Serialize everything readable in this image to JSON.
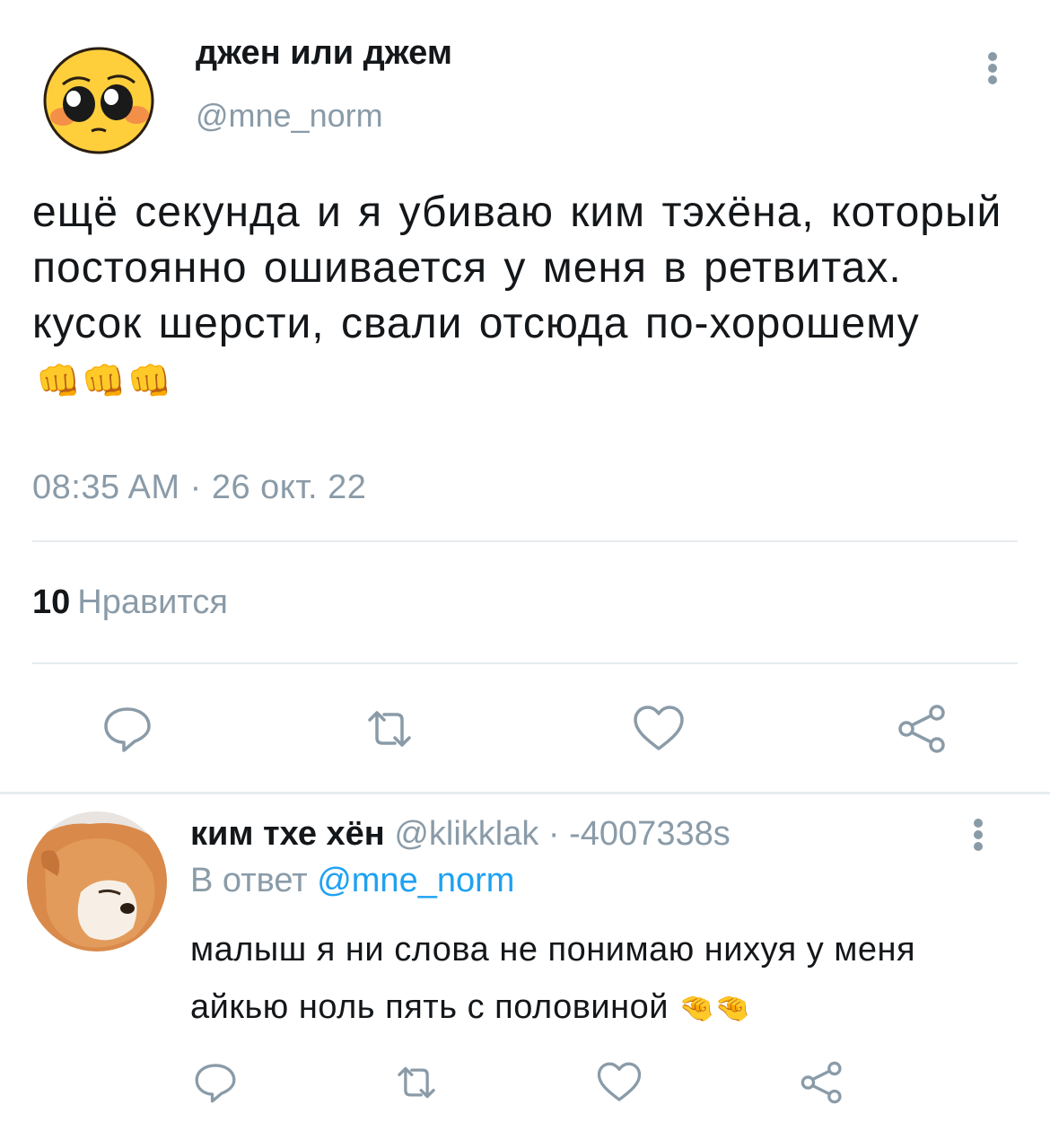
{
  "tweet": {
    "author_name": "джен или джем",
    "author_handle": "@mne_norm",
    "avatar_icon": "blushing-emoji-avatar",
    "text": "ещё секунда и я убиваю ким тэхёна, который постоянно ошивается у меня в ретвитах. кусок шерсти, свали отсюда по-хорошему",
    "emoji": "👊👊👊",
    "timestamp": "08:35 AM · 26 окт. 22",
    "likes_count": "10",
    "likes_label": "Нравится"
  },
  "reply": {
    "author_name": "ким тхе хён",
    "meta": " @klikklak · -4007338s",
    "reply_prefix": "В ответ ",
    "reply_mention": "@mne_norm",
    "avatar_icon": "shiba-dog-avatar",
    "text": "малыш я ни слова не понимаю нихуя у меня айкью ноль пять с половиной",
    "emoji": "🤏🤏"
  },
  "actions": [
    "reply-icon",
    "retweet-icon",
    "like-icon",
    "share-icon"
  ],
  "colors": {
    "text": "#14171a",
    "secondary": "#8a9ba8",
    "link": "#1da1f2",
    "divider": "#e6ecf0"
  }
}
